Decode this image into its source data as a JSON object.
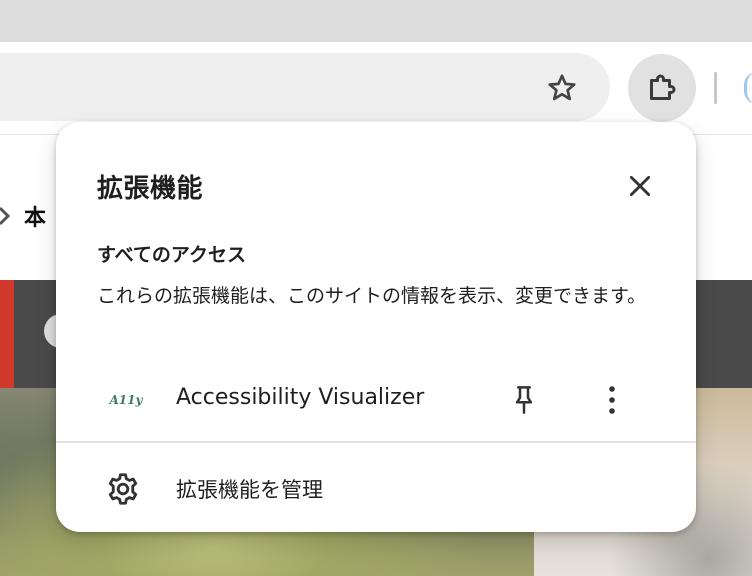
{
  "popup": {
    "title": "拡張機能",
    "access_heading": "すべてのアクセス",
    "access_description": "これらの拡張機能は、このサイトの情報を表示、変更できます。",
    "extensions": [
      {
        "name": "Accessibility Visualizer",
        "logo_text": "A11y",
        "icon": "accessibility-visualizer-logo"
      }
    ],
    "manage_label": "拡張機能を管理",
    "icons": {
      "close": "close-icon",
      "pin": "pin-icon",
      "more": "more-vert-icon",
      "manage": "gear-icon"
    }
  },
  "toolbar": {
    "icons": {
      "bookmark": "star-icon",
      "extensions": "puzzle-icon"
    }
  },
  "page": {
    "breadcrumb_fragment": "本",
    "colors": {
      "banner_accent": "#d03a2c",
      "banner": "#4a4a4a"
    }
  }
}
